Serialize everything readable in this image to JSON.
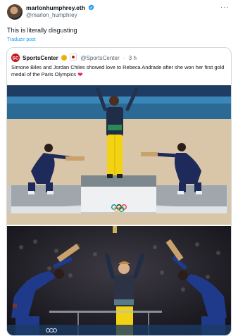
{
  "tweet": {
    "author_name": "marlonhumphrey.eth",
    "author_handle": "@marlon_humphrey",
    "text": "This is literally disgusting",
    "translate_label": "Traduzir post",
    "more_label": "···"
  },
  "quoted": {
    "author_name": "SportsCenter",
    "author_handle": "@SportsCenter",
    "separator": "·",
    "time": "3 h",
    "text": "Simone Biles and Jordan Chiles showed love to Rebeca Andrade after she won her first gold medal of the Paris Olympics",
    "heart": "❤"
  },
  "media": {
    "photo1_icon": "podium-photo",
    "photo2_icon": "podium-photo-bowing",
    "olympic_rings": "olympic-rings"
  },
  "colors": {
    "accent": "#1d9bf0",
    "verified": "#1d9bf0",
    "brand_red": "#c4161c",
    "heart": "#e0245e"
  }
}
